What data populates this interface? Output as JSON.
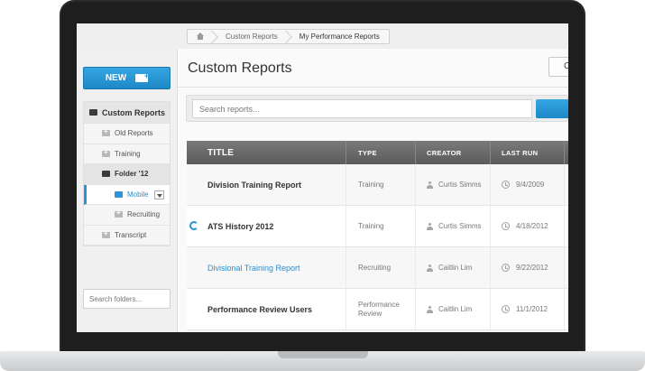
{
  "breadcrumb": {
    "items": [
      "Custom Reports",
      "My Performance Reports"
    ]
  },
  "sidebar": {
    "new_label": "NEW",
    "tree": {
      "root": "Custom Reports",
      "items": [
        {
          "label": "Old Reports"
        },
        {
          "label": "Training"
        },
        {
          "label": "Folder '12"
        },
        {
          "label": "Mobile"
        },
        {
          "label": "Recruiting"
        },
        {
          "label": "Transcript"
        }
      ]
    },
    "search_placeholder": "Search folders..."
  },
  "main": {
    "title": "Custom Reports",
    "right_button_label": "C",
    "search_placeholder": "Search reports..."
  },
  "table": {
    "headers": {
      "title": "TITLE",
      "type": "TYPE",
      "creator": "CREATOR",
      "last_run": "LAST RUN"
    },
    "rows": [
      {
        "title": "Division Training Report",
        "type": "Training",
        "creator": "Curtis Simms",
        "last_run": "9/4/2009"
      },
      {
        "title": "ATS History 2012",
        "type": "Training",
        "creator": "Curtis Simms",
        "last_run": "4/18/2012"
      },
      {
        "title": "Divisional Training Report",
        "type": "Recruiting",
        "creator": "Caitlin Lim",
        "last_run": "9/22/2012"
      },
      {
        "title": "Performance Review Users",
        "type": "Performance Review",
        "creator": "Caitlin Lim",
        "last_run": "11/1/2012"
      }
    ]
  },
  "colors": {
    "accent": "#2a93d1",
    "header_bg": "#6a6a6a",
    "frame": "#2b2b2b"
  }
}
